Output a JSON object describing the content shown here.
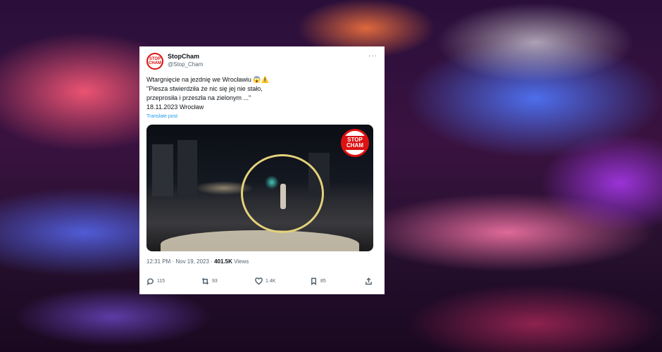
{
  "tweet": {
    "display_name": "StopCham",
    "handle": "@Stop_Cham",
    "avatar_text": "STOP CHAM",
    "more_label": "···",
    "lines": [
      "Wtargnięcie na jezdnię we Wrocławiu 😱⚠️",
      "\"Piesza stwierdziła że nic się jej nie stało,",
      "przeprosiła i przeszła na zielonym ...\"",
      "18.11.2023 Wrocław"
    ],
    "translate_label": "Translate post",
    "media_logo_text": "STOP CHAM",
    "time": "12:31 PM · Nov 19, 2023 · ",
    "views_count": "401.5K",
    "views_label": " Views",
    "actions": {
      "replies": "115",
      "reposts": "93",
      "likes": "1.4K",
      "bookmarks": "85"
    }
  },
  "colors": {
    "brand_red": "#dd1111",
    "link_blue": "#1d9bf0",
    "annotation_circle": "#e4d27a"
  }
}
